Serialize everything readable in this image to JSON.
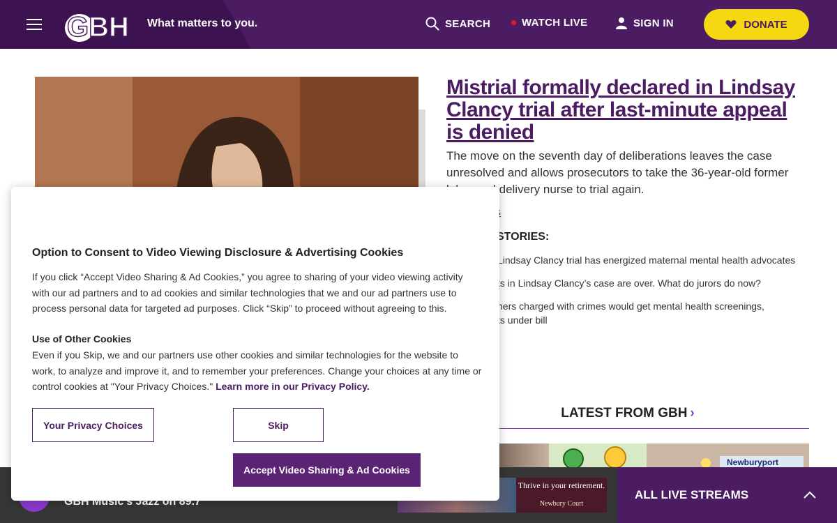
{
  "header": {
    "tagline": "What matters to you.",
    "logo_text": "GBH",
    "nav": {
      "search": "SEARCH",
      "watch_live": "WATCH LIVE",
      "sign_in": "SIGN IN",
      "donate": "DONATE"
    },
    "colors": {
      "brand": "#4b1c61",
      "donate": "#f6d812",
      "live": "#e0182b"
    }
  },
  "article": {
    "headline": "Mistrial formally declared in Lindsay Clancy trial after last-minute appeal is denied",
    "dek": "The move on the seventh day of deliberations leaves the case unresolved and allows prosecutors to take the 36-year-old former labor and delivery nurse to trial again.",
    "byline": "s",
    "related_heading": "STORIES:",
    "related": [
      "Lindsay Clancy trial has energized maternal mental health advocates",
      "ts in Lindsay Clancy’s case are over. What do jurors do now?",
      "hers charged with crimes would get mental health screenings,",
      "ts under bill"
    ]
  },
  "latest": {
    "heading": "LATEST FROM GBH",
    "chevron": "›",
    "thumb_label": "Newburyport"
  },
  "player": {
    "now_playing": "GBH Music’s Jazz on 89.7",
    "ad_title": "Thrive in your retirement.",
    "ad_brand": "Newbury Court",
    "streams": "ALL LIVE STREAMS"
  },
  "consent": {
    "title": "Option to Consent to Video Viewing Disclosure & Advertising Cookies",
    "p1": "If you click “Accept Video Sharing & Ad Cookies,” you agree to sharing of your video viewing activity with our ad partners and to ad cookies and similar technologies that we and our ad partners use to process personal data for targeted ad purposes. Click “Skip” to proceed without agreeing to this.",
    "sub": "Use of Other Cookies",
    "p2": "Even if you Skip, we and our partners use other cookies and similar technologies for the website to work, to analyze and improve it, and to remember your preferences. Change your choices at any time or control cookies at \"Your Privacy Choices.\"",
    "link": "Learn more in our Privacy Policy.",
    "btn_privacy": "Your Privacy Choices",
    "btn_skip": "Skip",
    "btn_accept": "Accept Video Sharing & Ad Cookies"
  }
}
